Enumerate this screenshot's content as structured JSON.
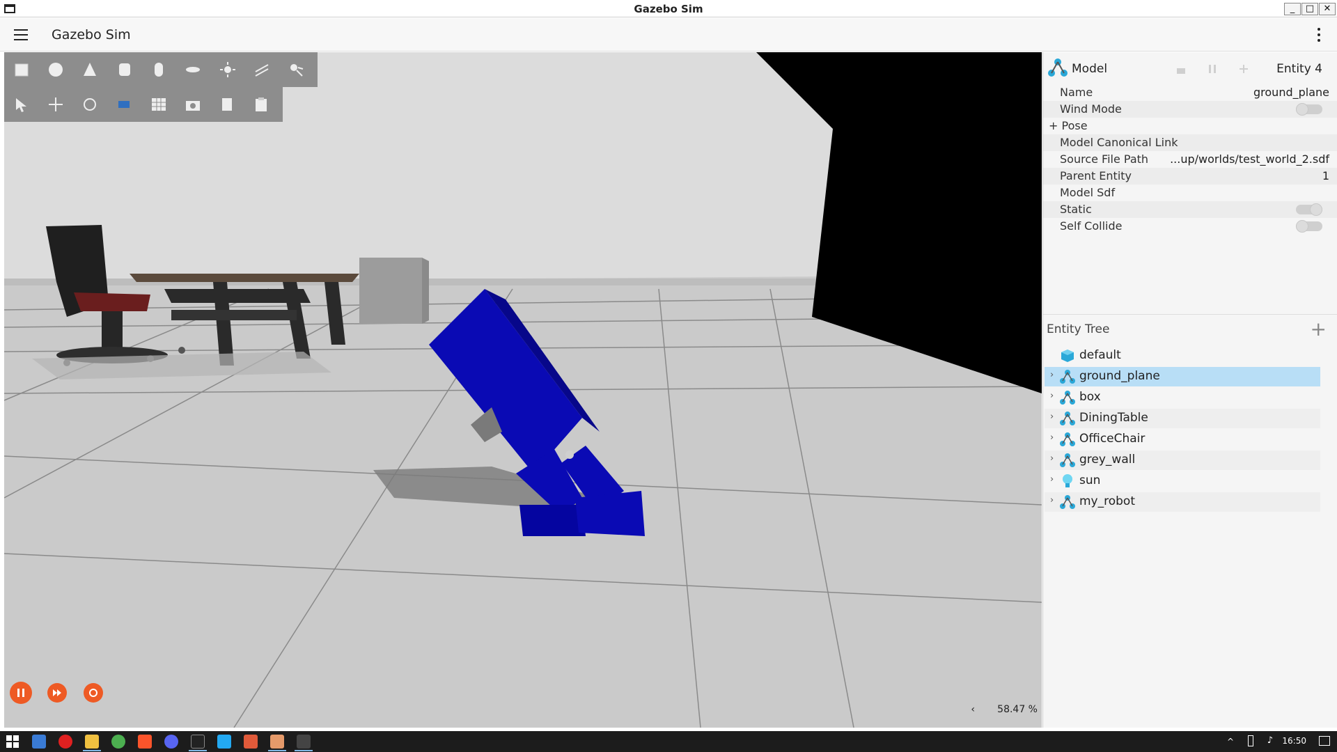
{
  "window": {
    "title": "Gazebo Sim",
    "buttons": {
      "minimize": "_",
      "maximize": "□",
      "close": "✕"
    }
  },
  "app": {
    "title": "Gazebo Sim",
    "menu_icon": "hamburger-icon",
    "overflow_icon": "kebab-menu-icon"
  },
  "toolbar": {
    "shapes": [
      "box-icon",
      "sphere-icon",
      "cone-icon",
      "cylinder-icon",
      "capsule-icon",
      "ellipsoid-icon",
      "sun-light-icon",
      "directional-light-icon",
      "spot-light-icon"
    ],
    "tools": [
      "select-arrow-icon",
      "translate-icon",
      "rotate-icon",
      "transform-icon",
      "grid-snap-icon",
      "camera-icon",
      "copy-icon",
      "paste-icon"
    ]
  },
  "playback": {
    "pause": "pause-icon",
    "step": "fast-forward-icon",
    "reset": "reset-icon"
  },
  "viewport": {
    "zoom_chevron": "‹",
    "rtf": "58.47 %"
  },
  "component_inspector": {
    "type_label": "Model",
    "entity_label": "Entity 4",
    "properties": [
      {
        "key": "Name",
        "value": "ground_plane"
      },
      {
        "key": "Wind Mode",
        "toggle": false
      },
      {
        "key": "+ Pose",
        "value": ""
      },
      {
        "key": "Model Canonical Link",
        "value": ""
      },
      {
        "key": "Source File Path",
        "value": "...up/worlds/test_world_2.sdf"
      },
      {
        "key": "Parent Entity",
        "value": "1"
      },
      {
        "key": "Model Sdf",
        "value": ""
      },
      {
        "key": "Static",
        "toggle": true
      },
      {
        "key": "Self Collide",
        "toggle": false
      }
    ]
  },
  "entity_tree": {
    "title": "Entity Tree",
    "add": "+",
    "items": [
      {
        "name": "default",
        "icon": "world-cube-icon",
        "expandable": false
      },
      {
        "name": "ground_plane",
        "icon": "model-icon",
        "expandable": true,
        "selected": true
      },
      {
        "name": "box",
        "icon": "model-icon",
        "expandable": true
      },
      {
        "name": "DiningTable",
        "icon": "model-icon",
        "expandable": true
      },
      {
        "name": "OfficeChair",
        "icon": "model-icon",
        "expandable": true
      },
      {
        "name": "grey_wall",
        "icon": "model-icon",
        "expandable": true
      },
      {
        "name": "sun",
        "icon": "light-bulb-icon",
        "expandable": true
      },
      {
        "name": "my_robot",
        "icon": "model-icon",
        "expandable": true
      }
    ]
  },
  "taskbar": {
    "clock": "16:50",
    "apps": [
      "windows-start-icon",
      "app-icon",
      "youtube-icon",
      "file-explorer-icon",
      "chrome-icon",
      "brave-icon",
      "discord-icon",
      "terminal-icon",
      "vscode-icon",
      "app-icon",
      "gazebo-icon",
      "ros-icon"
    ]
  },
  "colors": {
    "accent": "#ee5a24",
    "selection": "#b8def6",
    "robot": "#0a0ab4"
  }
}
